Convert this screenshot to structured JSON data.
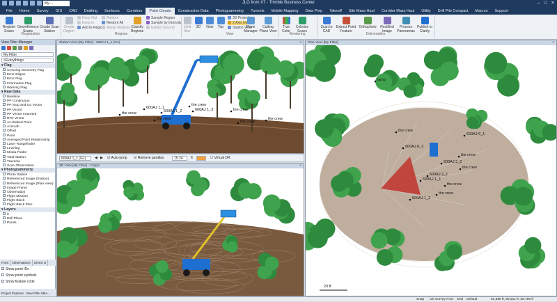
{
  "window": {
    "title": "JLG from X7 - Trimble Business Center",
    "combo_value": "My ..."
  },
  "menu": [
    "File",
    "Home",
    "Survey",
    "GIS",
    "CAD",
    "Drafting",
    "Surfaces",
    "Corridors",
    "Point Clouds",
    "Construction Data",
    "Photogrammetry",
    "Tunnels",
    "Mobile Mapping",
    "Data Prep",
    "Takeoff",
    "Site Mass Haul",
    "Corridor Mass Haul",
    "Utility",
    "Drill Pile Compact",
    "Macros",
    "Support"
  ],
  "active_menu": "Point Clouds",
  "ribbon": {
    "register_scans": "Register Scans",
    "georeference_scans": "Georeference Scans",
    "create_scan_station": "Create Scan Station",
    "group_registration": "Registration",
    "create_region": "Create Region",
    "keep_out": "Keep Out",
    "keep_in": "Keep In",
    "add_to_region": "Add to Region",
    "restore": "Restore",
    "restore_all": "Restore All",
    "merge_regions": "Merge Regions",
    "classify_regions": "Classify Regions",
    "sample_region": "Sample Region",
    "sample_by_intensity": "Sample by Intensity",
    "extract_ground": "Extract Ground",
    "group_regions": "Regions",
    "limit_box": "Limit Box",
    "btn_3d": "3D",
    "view": "View",
    "top": "Top",
    "projection": "3D Projection",
    "axis_up": "Z Axis Up",
    "station_view": "Station View",
    "plane_manager": "Plane Manager",
    "cutting_plane_view": "Cutting Plane View",
    "group_view": "View",
    "true_color": "True Color",
    "colorize_scans": "Colorize Scans",
    "group_rendering": "Rendering",
    "scan_to_cad": "Scan to CAD",
    "extract_point_feature": "Extract Point Feature",
    "orthophoto": "Orthophoto",
    "rectified_image": "Rectified Image",
    "process_panoramas": "Process Panoramas",
    "publish_to_clarity": "Publish to Clarity",
    "group_deliverables": "Deliverables"
  },
  "left_panel": {
    "title": "View Filter Manager",
    "filter_value": "My Filter",
    "everything_value": "<Everything>",
    "groups": [
      {
        "name": "Flag",
        "items": [
          "Crossing Geometry Flag",
          "Error Ellipse",
          "Error Flag",
          "Information Flag",
          "Warning Flag"
        ]
      },
      {
        "name": "Raw Data",
        "items": [
          "Baseline",
          "PP Continuous",
          "PP Stop and Go Vector",
          "PP Vector",
          "PP Vector Imported",
          "RTK Vector",
          "As-Staked Point",
          "Azimuth",
          "Offset",
          "Point",
          "Averaged Point Relationship",
          "Laser Rangefinder",
          "Leveling",
          "Media Folder",
          "Total Station",
          "Traverse",
          "Scan Observation"
        ]
      },
      {
        "name": "Photogrammetry",
        "items": [
          "Photo Station",
          "Referenced Image (Station)",
          "Referenced Image (Plan View)",
          "Image Frame",
          "Observation",
          "Flight Mission",
          "Flight Block",
          "Flight Block Plan"
        ]
      },
      {
        "name": "Layers",
        "items": [
          "0",
          "Drill Plans",
          "Points"
        ]
      }
    ],
    "tabs": [
      "Point",
      "Observations",
      "GNSS O"
    ],
    "options": [
      "Show point IDs",
      "Show point symbols",
      "Show feature code"
    ],
    "bottom_tabs": [
      "Project Explorer",
      "View Filter Man..."
    ]
  },
  "station_view": {
    "title": "Station View [My Filter] - 600AJ 1_1 (G1)",
    "station_select": "600AJ 1_1 (G1)",
    "auto_jump": "Auto-jump",
    "remove_parallax": "Remove parallax",
    "value": "15.24",
    "virtual_dr": "Virtual DR",
    "labels": [
      "600AJ 1_1",
      "600AJ 1_2",
      "600AJ 1_3",
      "the crew",
      "the crew",
      "the crew",
      "the crew",
      "the crew",
      "the crew"
    ]
  },
  "view3d": {
    "title": "3D View [My Filter] - Copy1"
  },
  "plan_view": {
    "title": "Plan View [My Filter]",
    "labels": [
      "lamp",
      "the crew",
      "600AJ 6_1",
      "600AJ 6_2",
      "the crew",
      "the crew",
      "600AJ 3_2",
      "600AJ 2_1",
      "the crew",
      "600AJ 1_1",
      "the crew",
      "600AJ 1_2"
    ],
    "scale": "20 ft"
  },
  "status": {
    "snap": "Snap",
    "system": "US Survey Foot",
    "grid": "Grid",
    "default": "Default",
    "coords": "61,380 ft, 59,211 ft, 26,789 ft"
  },
  "colors": {
    "title_bg": "#1f3a5f",
    "tree": "#2e8b3e",
    "ground": "#6e4a2e",
    "machine": "#1f6fd1",
    "cone": "#c0332b"
  }
}
